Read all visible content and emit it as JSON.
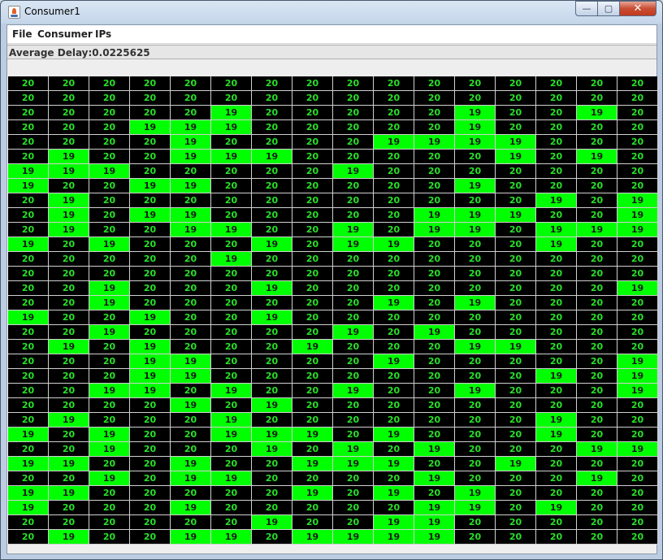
{
  "window": {
    "title": "Consumer1",
    "caption": {
      "minimize": "—",
      "maximize": "▢",
      "close": "✕"
    }
  },
  "menubar": {
    "items": [
      "File",
      "Consumer",
      "IPs"
    ]
  },
  "status": {
    "average_delay": "Average Delay:0.0225625"
  },
  "colors": {
    "value_20_bg": "#000000",
    "value_20_fg": "#28e028",
    "value_19_bg": "#00ff00",
    "value_19_fg": "#1a1a1a"
  },
  "grid": {
    "rows": [
      [
        20,
        20,
        20,
        20,
        20,
        20,
        20,
        20,
        20,
        20,
        20,
        20,
        20,
        20,
        20,
        20
      ],
      [
        20,
        20,
        20,
        20,
        20,
        20,
        20,
        20,
        20,
        20,
        20,
        20,
        20,
        20,
        20,
        20
      ],
      [
        20,
        20,
        20,
        20,
        20,
        19,
        20,
        20,
        20,
        20,
        20,
        19,
        20,
        20,
        19,
        20
      ],
      [
        20,
        20,
        20,
        19,
        19,
        19,
        20,
        20,
        20,
        20,
        20,
        19,
        20,
        20,
        20,
        20
      ],
      [
        20,
        20,
        20,
        20,
        19,
        20,
        20,
        20,
        20,
        19,
        19,
        19,
        19,
        20,
        20,
        20
      ],
      [
        20,
        19,
        20,
        20,
        19,
        19,
        19,
        20,
        20,
        20,
        20,
        20,
        19,
        20,
        19,
        20
      ],
      [
        19,
        19,
        19,
        20,
        20,
        20,
        20,
        20,
        19,
        20,
        20,
        20,
        20,
        20,
        20,
        20
      ],
      [
        19,
        20,
        20,
        19,
        19,
        20,
        20,
        20,
        20,
        20,
        20,
        19,
        20,
        20,
        20,
        20
      ],
      [
        20,
        19,
        20,
        20,
        20,
        20,
        20,
        20,
        20,
        20,
        20,
        20,
        20,
        19,
        20,
        19
      ],
      [
        20,
        19,
        20,
        19,
        19,
        20,
        20,
        20,
        20,
        20,
        19,
        19,
        19,
        20,
        20,
        19
      ],
      [
        20,
        19,
        20,
        20,
        19,
        19,
        20,
        20,
        19,
        20,
        19,
        19,
        20,
        19,
        19,
        19
      ],
      [
        19,
        20,
        19,
        20,
        20,
        20,
        19,
        20,
        19,
        19,
        20,
        20,
        20,
        19,
        20,
        20
      ],
      [
        20,
        20,
        20,
        20,
        20,
        19,
        20,
        20,
        20,
        20,
        20,
        20,
        20,
        20,
        20,
        20
      ],
      [
        20,
        20,
        20,
        20,
        20,
        20,
        20,
        20,
        20,
        20,
        20,
        20,
        20,
        20,
        20,
        20
      ],
      [
        20,
        20,
        19,
        20,
        20,
        20,
        19,
        20,
        20,
        20,
        20,
        20,
        20,
        20,
        20,
        19
      ],
      [
        20,
        20,
        19,
        20,
        20,
        20,
        20,
        20,
        20,
        19,
        20,
        19,
        20,
        20,
        20,
        20
      ],
      [
        19,
        20,
        20,
        19,
        20,
        20,
        19,
        20,
        20,
        20,
        20,
        20,
        20,
        20,
        20,
        20
      ],
      [
        20,
        20,
        19,
        20,
        20,
        20,
        20,
        20,
        19,
        20,
        19,
        20,
        20,
        20,
        20,
        20
      ],
      [
        20,
        19,
        20,
        19,
        20,
        20,
        20,
        19,
        20,
        20,
        20,
        19,
        19,
        20,
        20,
        20
      ],
      [
        20,
        20,
        20,
        19,
        19,
        20,
        20,
        20,
        20,
        19,
        20,
        20,
        20,
        20,
        20,
        19
      ],
      [
        20,
        20,
        20,
        19,
        19,
        20,
        20,
        20,
        20,
        20,
        20,
        20,
        20,
        19,
        20,
        19
      ],
      [
        20,
        20,
        19,
        19,
        20,
        19,
        20,
        20,
        19,
        20,
        20,
        19,
        20,
        20,
        20,
        19
      ],
      [
        20,
        20,
        20,
        20,
        19,
        20,
        19,
        20,
        20,
        20,
        20,
        20,
        20,
        20,
        20,
        20
      ],
      [
        20,
        19,
        20,
        20,
        20,
        19,
        20,
        20,
        20,
        20,
        20,
        20,
        20,
        19,
        20,
        20
      ],
      [
        19,
        20,
        19,
        20,
        20,
        19,
        19,
        19,
        20,
        19,
        20,
        20,
        20,
        19,
        20,
        20
      ],
      [
        20,
        20,
        19,
        20,
        20,
        20,
        19,
        20,
        19,
        20,
        19,
        20,
        20,
        20,
        19,
        19
      ],
      [
        19,
        19,
        20,
        20,
        19,
        20,
        20,
        19,
        19,
        19,
        20,
        20,
        19,
        20,
        20,
        20
      ],
      [
        20,
        20,
        19,
        20,
        19,
        19,
        20,
        20,
        20,
        20,
        19,
        20,
        20,
        20,
        19,
        20
      ],
      [
        19,
        19,
        20,
        20,
        20,
        20,
        20,
        19,
        20,
        19,
        20,
        19,
        20,
        20,
        20,
        20
      ],
      [
        19,
        20,
        20,
        20,
        19,
        20,
        20,
        20,
        20,
        20,
        19,
        19,
        20,
        19,
        20,
        20
      ],
      [
        20,
        20,
        20,
        20,
        20,
        20,
        19,
        20,
        20,
        19,
        19,
        20,
        20,
        20,
        20,
        20
      ],
      [
        20,
        19,
        20,
        20,
        19,
        19,
        20,
        19,
        19,
        19,
        19,
        20,
        20,
        20,
        20,
        20
      ]
    ]
  }
}
